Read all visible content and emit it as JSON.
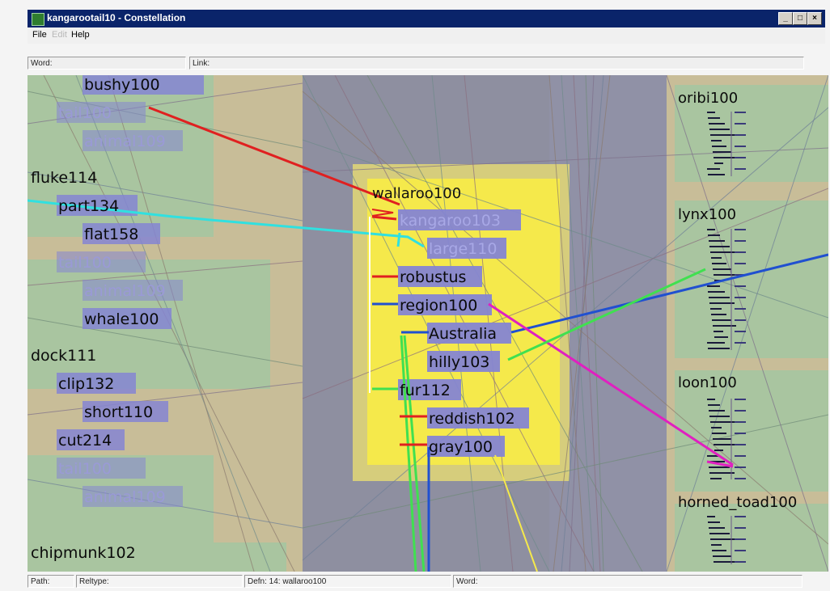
{
  "window": {
    "title": "kangarootail10 - Constellation",
    "controls": {
      "minimize": "_",
      "maximize": "□",
      "close": "×"
    }
  },
  "menu": {
    "file": "File",
    "edit": "Edit",
    "help": "Help"
  },
  "fields": {
    "word_label": "Word:",
    "link_label": "Link:"
  },
  "status": {
    "path": "Path:",
    "reltype": "Reltype:",
    "defn": "Defn: 14:  wallaroo100",
    "word": "Word:"
  },
  "colors": {
    "accent_title": "#0a246a",
    "highlight_box": "#f5e94b",
    "node_fill": "#8585d2",
    "link_red": "#e02020",
    "link_cyan": "#30e0e0",
    "link_blue": "#2050d0",
    "link_green": "#40e050",
    "link_magenta": "#e020c0"
  },
  "graph": {
    "left_nodes": [
      {
        "label": "bushy100",
        "dim": false,
        "boxed": true
      },
      {
        "label": "tail100",
        "dim": true,
        "boxed": true
      },
      {
        "label": "animal109",
        "dim": true,
        "boxed": true
      },
      {
        "label": "fluke114",
        "dim": false,
        "boxed": false
      },
      {
        "label": "part134",
        "dim": false,
        "boxed": true
      },
      {
        "label": "flat158",
        "dim": false,
        "boxed": true
      },
      {
        "label": "tail100",
        "dim": true,
        "boxed": true
      },
      {
        "label": "animal109",
        "dim": true,
        "boxed": true
      },
      {
        "label": "whale100",
        "dim": false,
        "boxed": true
      },
      {
        "label": "dock111",
        "dim": false,
        "boxed": false
      },
      {
        "label": "clip132",
        "dim": false,
        "boxed": true
      },
      {
        "label": "short110",
        "dim": false,
        "boxed": true
      },
      {
        "label": "cut214",
        "dim": false,
        "boxed": true
      },
      {
        "label": "tail100",
        "dim": true,
        "boxed": true
      },
      {
        "label": "animal109",
        "dim": true,
        "boxed": true
      },
      {
        "label": "chipmunk102",
        "dim": false,
        "boxed": false
      }
    ],
    "center": {
      "root": "wallaroo100",
      "nodes": [
        {
          "label": "kangaroo103",
          "dim": true
        },
        {
          "label": "large110",
          "dim": true
        },
        {
          "label": "robustus",
          "dim": false
        },
        {
          "label": "region100",
          "dim": false
        },
        {
          "label": "Australia",
          "dim": false
        },
        {
          "label": "hilly103",
          "dim": false
        },
        {
          "label": "fur112",
          "dim": false
        },
        {
          "label": "reddish102",
          "dim": false
        },
        {
          "label": "gray100",
          "dim": false
        }
      ]
    },
    "right_nodes": [
      {
        "label": "oribi100"
      },
      {
        "label": "lynx100"
      },
      {
        "label": "loon100"
      },
      {
        "label": "horned_toad100"
      }
    ]
  }
}
